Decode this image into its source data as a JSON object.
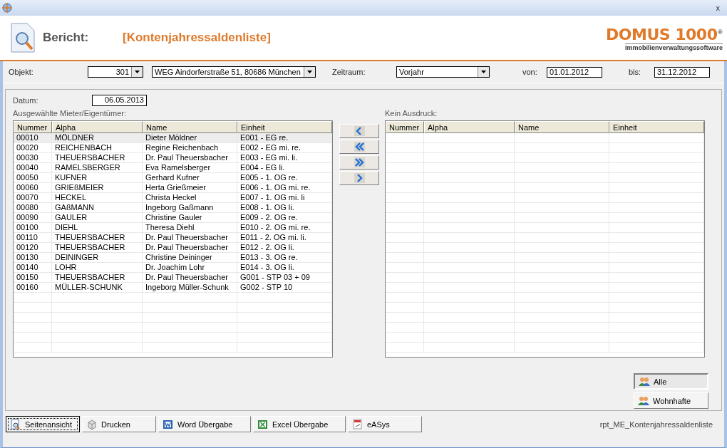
{
  "window": {
    "close": "x"
  },
  "header": {
    "label": "Bericht:",
    "report": "[Kontenjahressaldenliste]",
    "logo": {
      "name": "DOMUS 1000",
      "mark": "®",
      "tagline": "Immobilienverwaltungssoftware"
    }
  },
  "filters": {
    "objekt_label": "Objekt:",
    "objekt": "301",
    "address": "WEG Aindorferstraße 51, 80686 München",
    "zeitraum_label": "Zeitraum:",
    "zeitraum": "Vorjahr",
    "von_label": "von:",
    "von": "01.01.2012",
    "bis_label": "bis:",
    "bis": "31.12.2012"
  },
  "datum": {
    "label": "Datum:",
    "value": "06.05.2013"
  },
  "left_table": {
    "title": "Ausgewählte Mieter/Eigentümer:",
    "columns": [
      "Nummer",
      "Alpha",
      "Name",
      "Einheit"
    ],
    "rows": [
      {
        "cells": [
          "00010",
          "MÖLDNER",
          "Dieter Möldner",
          "E001 - EG re."
        ],
        "selected": true
      },
      {
        "cells": [
          "00020",
          "REICHENBACH",
          "Regine Reichenbach",
          "E002 - EG mi. re."
        ],
        "selected": false
      },
      {
        "cells": [
          "00030",
          "THEUERSBACHER",
          "Dr. Paul Theuersbacher",
          "E003 - EG mi. li."
        ],
        "selected": false
      },
      {
        "cells": [
          "00040",
          "RAMELSBERGER",
          "Eva Ramelsberger",
          "E004 - EG li."
        ],
        "selected": false
      },
      {
        "cells": [
          "00050",
          "KUFNER",
          "Gerhard Kufner",
          "E005 - 1. OG re."
        ],
        "selected": false
      },
      {
        "cells": [
          "00060",
          "GRIEßMEIER",
          "Herta Grießmeier",
          "E006 - 1. OG mi. re."
        ],
        "selected": false
      },
      {
        "cells": [
          "00070",
          "HECKEL",
          "Christa Heckel",
          "E007 - 1. OG mi. li"
        ],
        "selected": false
      },
      {
        "cells": [
          "00080",
          "GAßMANN",
          "Ingeborg Gaßmann",
          "E008 - 1. OG li."
        ],
        "selected": false
      },
      {
        "cells": [
          "00090",
          "GAULER",
          "Christine Gauler",
          "E009 - 2. OG re."
        ],
        "selected": false
      },
      {
        "cells": [
          "00100",
          "DIEHL",
          "Theresa Diehl",
          "E010 - 2. OG mi. re."
        ],
        "selected": false
      },
      {
        "cells": [
          "00110",
          "THEUERSBACHER",
          "Dr. Paul Theuersbacher",
          "E011 - 2. OG mi. li."
        ],
        "selected": false
      },
      {
        "cells": [
          "00120",
          "THEUERSBACHER",
          "Dr. Paul Theuersbacher",
          "E012 - 2. OG li."
        ],
        "selected": false
      },
      {
        "cells": [
          "00130",
          "DEININGER",
          "Christine Deininger",
          "E013 - 3. OG re."
        ],
        "selected": false
      },
      {
        "cells": [
          "00140",
          "LOHR",
          "Dr. Joachim Lohr",
          "E014 - 3. OG li."
        ],
        "selected": false
      },
      {
        "cells": [
          "00150",
          "THEUERSBACHER",
          "Dr. Paul Theuersbacher",
          "G001 - STP 03 + 09"
        ],
        "selected": false
      },
      {
        "cells": [
          "00160",
          "MÜLLER-SCHUNK",
          "Ingeborg Müller-Schunk",
          "G002 - STP 10"
        ],
        "selected": false
      }
    ]
  },
  "right_table": {
    "title": "Kein Ausdruck:",
    "columns": [
      "Nummer",
      "Alpha",
      "Name",
      "Einheit"
    ]
  },
  "move_buttons": [
    {
      "kind": "left"
    },
    {
      "kind": "all-left"
    },
    {
      "kind": "all-right"
    },
    {
      "kind": "right"
    }
  ],
  "filter_buttons": [
    {
      "label": "Alle",
      "selected": true
    },
    {
      "label": "Wohnhafte",
      "selected": false
    }
  ],
  "action_buttons": [
    {
      "label": "Seitenansicht",
      "kind": "preview"
    },
    {
      "label": "Drucken",
      "kind": "print"
    },
    {
      "label": "Word Übergabe",
      "kind": "word"
    },
    {
      "label": "Excel Übergabe",
      "kind": "excel"
    },
    {
      "label": "eASys",
      "kind": "easys"
    }
  ],
  "report_name": "rpt_ME_Kontenjahressaldenliste"
}
